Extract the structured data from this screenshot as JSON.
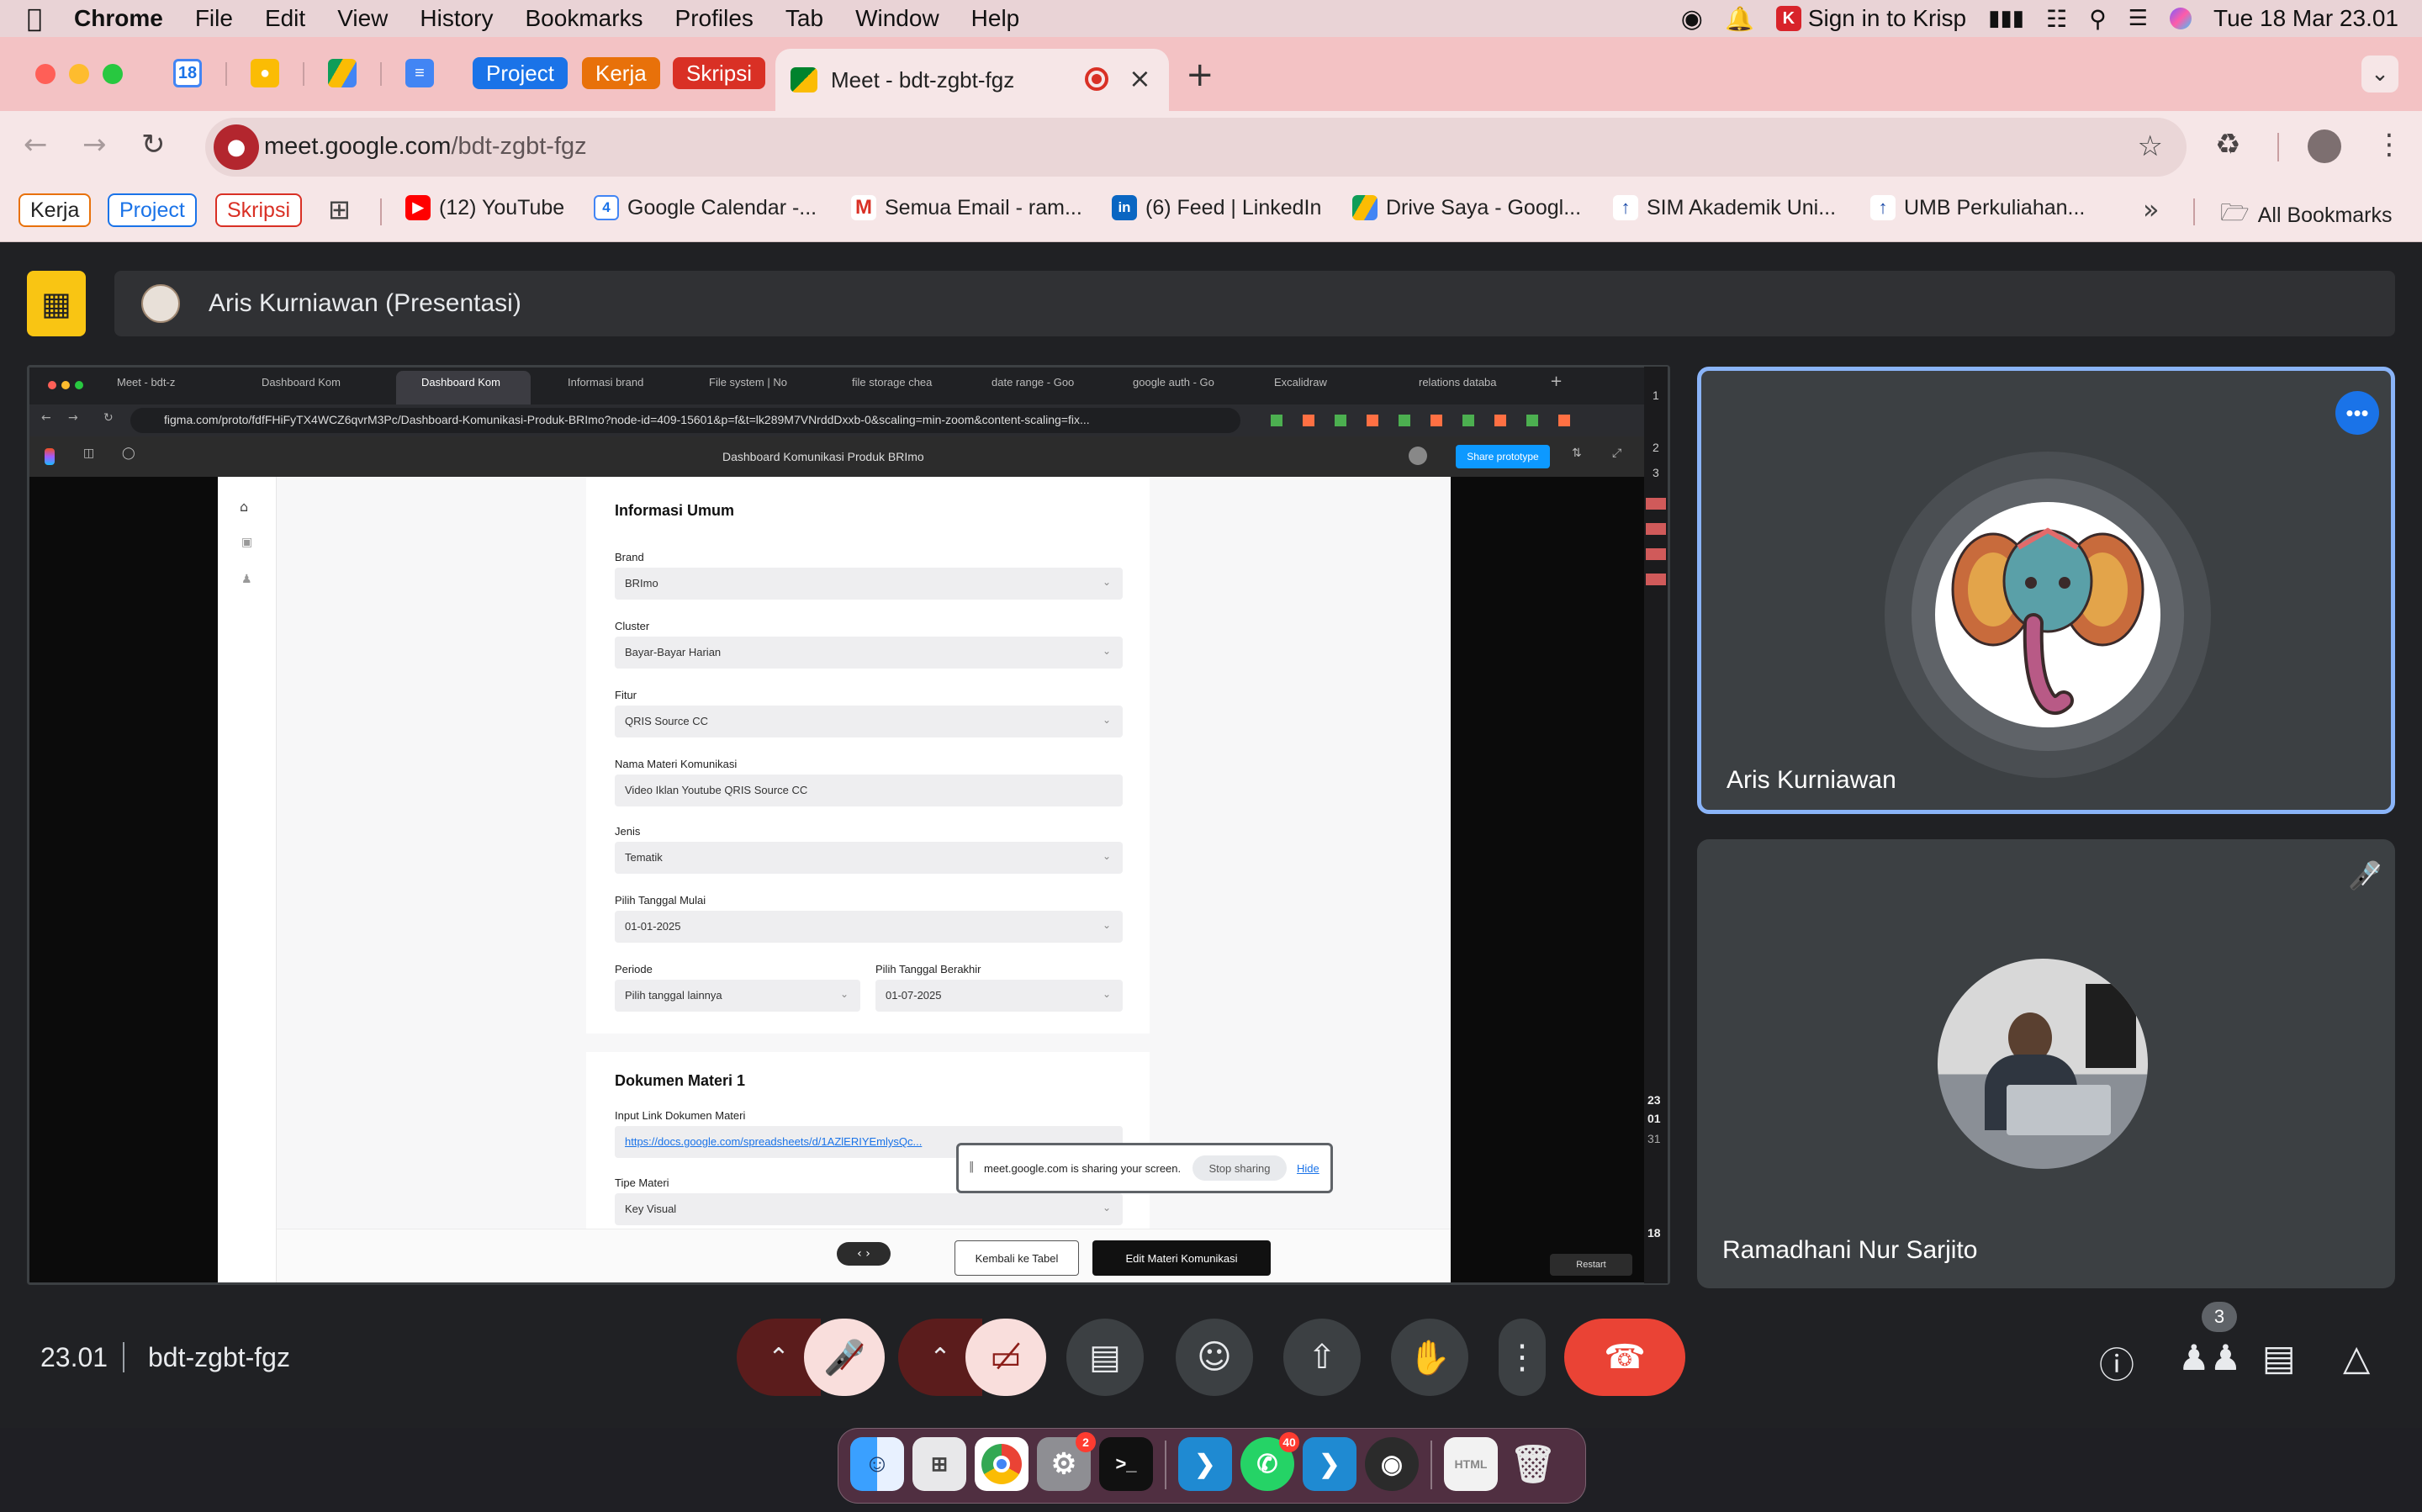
{
  "menubar": {
    "app": "Chrome",
    "items": [
      "File",
      "Edit",
      "View",
      "History",
      "Bookmarks",
      "Profiles",
      "Tab",
      "Window",
      "Help"
    ],
    "krisp": "Sign in to Krisp",
    "datetime": "Tue 18 Mar  23.01"
  },
  "tabs": {
    "calendar_day": "18",
    "groups": [
      "Project",
      "Kerja",
      "Skripsi"
    ],
    "active_title": "Meet - bdt-zgbt-fgz"
  },
  "toolbar": {
    "url_host": "meet.google.com",
    "url_path": "/bdt-zgbt-fgz"
  },
  "bookmarks": {
    "groups": [
      "Kerja",
      "Project",
      "Skripsi"
    ],
    "items": [
      "(12) YouTube",
      "Google Calendar -...",
      "Semua Email - ram...",
      "(6) Feed | LinkedIn",
      "Drive Saya - Googl...",
      "SIM Akademik Uni...",
      "UMB Perkuliahan..."
    ],
    "all": "All Bookmarks",
    "calendar_num": "4"
  },
  "meet": {
    "presenter": "Aris Kurniawan (Presentasi)",
    "time": "23.01",
    "code": "bdt-zgbt-fgz",
    "people_count": "3",
    "participants": [
      "Aris Kurniawan",
      "Ramadhani Nur Sarjito"
    ]
  },
  "shared": {
    "tabs": [
      "Meet - bdt-z",
      "Dashboard Kom",
      "Dashboard Kom",
      "Informasi brand",
      "File system | No",
      "file storage chea",
      "date range - Goo",
      "google auth - Go",
      "Excalidraw",
      "relations databa"
    ],
    "url": "figma.com/proto/fdfFHiFyTX4WCZ6qvrM3Pc/Dashboard-Komunikasi-Produk-BRImo?node-id=409-15601&p=f&t=lk289M7VNrddDxxb-0&scaling=min-zoom&content-scaling=fix...",
    "figma_title": "Dashboard Komunikasi Produk BRImo",
    "share_prototype": "Share prototype",
    "card1_title": "Informasi Umum",
    "fields": [
      {
        "label": "Brand",
        "value": "BRImo"
      },
      {
        "label": "Cluster",
        "value": "Bayar-Bayar Harian"
      },
      {
        "label": "Fitur",
        "value": "QRIS Source CC"
      },
      {
        "label": "Nama Materi Komunikasi",
        "value": "Video Iklan Youtube QRIS Source CC"
      },
      {
        "label": "Jenis",
        "value": "Tematik"
      },
      {
        "label": "Pilih Tanggal Mulai",
        "value": "01-01-2025"
      }
    ],
    "periode": {
      "label": "Periode",
      "value": "Pilih tanggal lainnya"
    },
    "tanggal_akhir": {
      "label": "Pilih Tanggal Berakhir",
      "value": "01-07-2025"
    },
    "card2_title": "Dokumen Materi 1",
    "link_label": "Input Link Dokumen Materi",
    "link_value": "https://docs.google.com/spreadsheets/d/1AZlERIYEmlysQc...",
    "tipe_label": "Tipe Materi",
    "tipe_value": "Key Visual",
    "sharing_msg": "meet.google.com is sharing your screen.",
    "stop_sharing": "Stop sharing",
    "hide": "Hide",
    "btn_back": "Kembali ke Tabel",
    "btn_edit": "Edit Materi Komunikasi",
    "restart": "Restart",
    "strip_nums": [
      "1",
      "2",
      "3"
    ],
    "strip_clock": [
      "23",
      "01",
      "31"
    ],
    "strip_date": "18"
  },
  "dock": {
    "settings_badge": "2",
    "whatsapp_badge": "40"
  },
  "colors": {
    "accent_blue": "#8ab4f8",
    "end_call_red": "#ea4335",
    "presentation_yellow": "#f9c513",
    "muted_bg": "#f9dedc"
  }
}
